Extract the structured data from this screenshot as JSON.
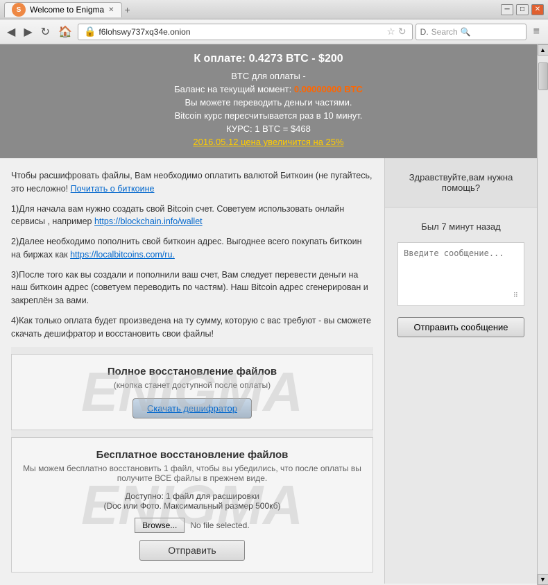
{
  "window": {
    "title": "Welcome to Enigma",
    "close_label": "✕",
    "min_label": "─",
    "max_label": "□",
    "new_tab": "+"
  },
  "nav": {
    "back": "◀",
    "forward": "▶",
    "refresh": "↻",
    "home": "🏠",
    "url": "f6lohswy737xq34e.onion",
    "search_placeholder": "Search",
    "menu": "≡"
  },
  "payment": {
    "title": "К оплате: 0.4273 BTC - $200",
    "btc_label": "BТС для оплаты -",
    "balance_label": "Баланс на текущий момент:",
    "balance_value": "0.00000000",
    "balance_unit": "BTC",
    "partial_label": "Вы можете переводить деньги частями.",
    "rate_label": "Bitcoin курс пересчитывается раз в 10 минут.",
    "rate_value": "КУРС: 1 BTC = $468",
    "price_increase": "2016.05.12 цена увеличится на 25%"
  },
  "instructions": {
    "intro": "Чтобы расшифровать файлы, Вам необходимо оплатить валютой Биткоин (не пугайтесь, это несложно!",
    "read_more": "Почитать о биткоине",
    "step1": "1)Для начала вам нужно создать свой Bitcoin счет. Советуем использовать онлайн сервисы , например",
    "step1_link": "https://blockchain.info/wallet",
    "step2": "2)Далее необходимо пополнить свой биткоин адрес. Выгоднее всего покупать биткоин на биржах как",
    "step2_link": "https://localbitcoins.com/ru.",
    "step3": "3)После того как вы создали и пополнили ваш счет, Вам следует перевести деньги на наш биткоин адрес (советуем переводить по частям). Наш Bitcoin адрес сгенерирован и закреплён за вами.",
    "step4": "4)Как только оплата будет произведена на ту сумму, которую с вас требуют - вы сможете скачать дешифратор и восстановить свои файлы!"
  },
  "full_recovery": {
    "title": "Полное восстановление файлов",
    "subtitle": "(кнопка станет доступной после оплаты)",
    "button": "Скачать дешифратор"
  },
  "free_recovery": {
    "title": "Бесплатное восстановление файлов",
    "description": "Мы можем бесплатно восстановить 1 файл, чтобы вы убедились, что после оплаты вы получите ВСЕ файлы в прежнем виде.",
    "available": "Доступно: 1 файл для расшировки",
    "file_types": "(Doc или Фото. Максимальный размер 500кб)",
    "browse_btn": "Browse...",
    "no_file": "No file selected.",
    "submit_btn": "Отправить"
  },
  "chat": {
    "greeting": "Здравствуйте,вам нужна помощь?",
    "last_seen": "Был 7 минут назад",
    "placeholder": "Введите сообщение...",
    "send_btn": "Отправить сообщение"
  },
  "watermark": "ENIGMA"
}
